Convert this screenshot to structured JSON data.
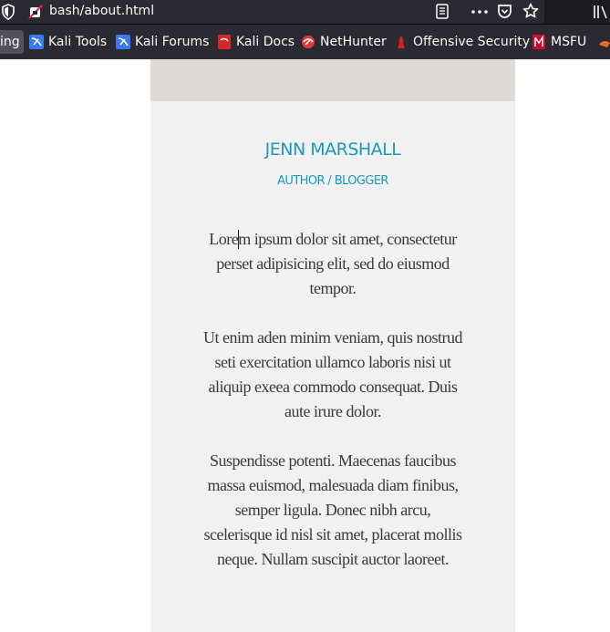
{
  "browser": {
    "url": "bash/about.html",
    "bookmarks": [
      {
        "label": "ing",
        "icon": "bookmark-folder-icon"
      },
      {
        "label": "Kali Tools",
        "icon": "kali-dragon-icon"
      },
      {
        "label": "Kali Forums",
        "icon": "kali-dragon-icon"
      },
      {
        "label": "Kali Docs",
        "icon": "kali-docs-icon"
      },
      {
        "label": "NetHunter",
        "icon": "nethunter-icon"
      },
      {
        "label": "Offensive Security",
        "icon": "offsec-icon"
      },
      {
        "label": "MSFU",
        "icon": "msfu-icon"
      }
    ]
  },
  "profile": {
    "name": "JENN MARSHALL",
    "role": "AUTHOR / BLOGGER",
    "paragraphs": [
      "Lorem ipsum dolor sit amet, consectetur perset adipisicing elit, sed do eiusmod tempor.",
      "Ut enim aden minim veniam, quis nostrud seti exercitation ullamco laboris nisi ut aliquip exeea commodo consequat. Duis aute irure dolor.",
      "Suspendisse potenti. Maecenas faucibus massa euismod, malesuada diam finibus, semper ligula. Donec nibh arcu, scelerisque id nisl sit amet, placerat mollis neque. Nullam suscipit auctor laoreet."
    ]
  },
  "colors": {
    "accent": "#1a9bb8",
    "header_band": "#dedad5",
    "card": "#f1f1f1",
    "toolbar": "#2b2a33"
  }
}
